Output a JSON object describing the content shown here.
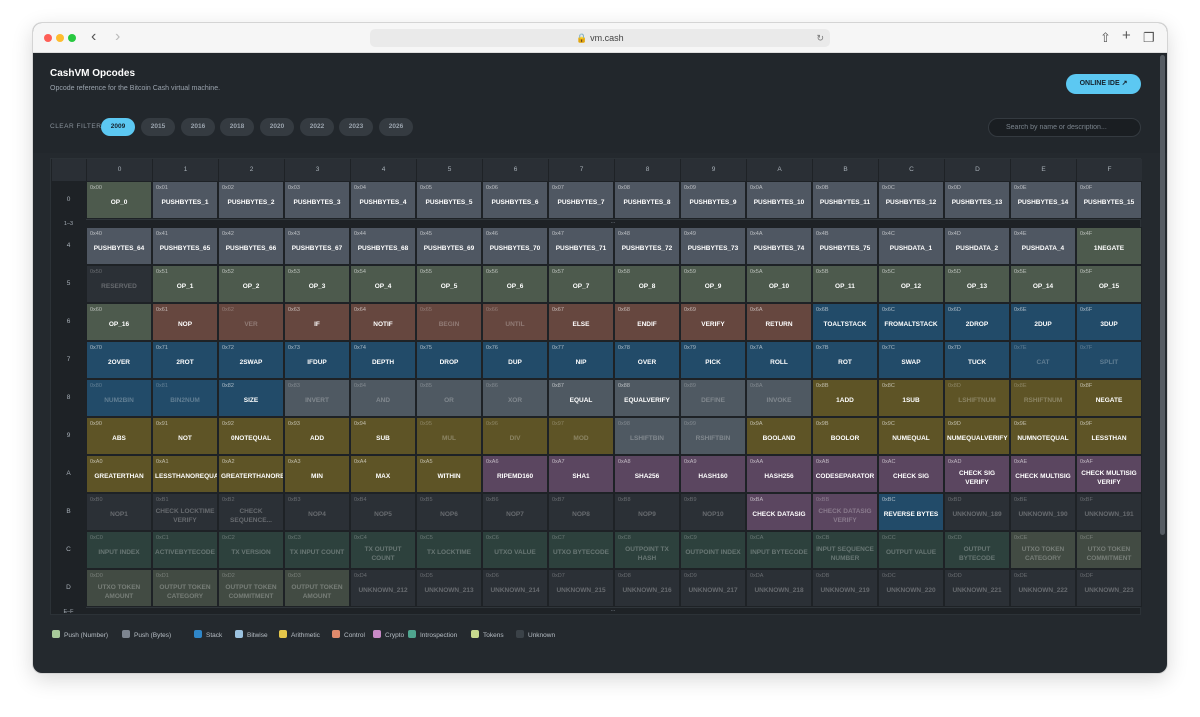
{
  "browser": {
    "url": "vm.cash",
    "back": "‹",
    "forward": "›"
  },
  "header": {
    "title": "CashVM Opcodes",
    "subtitle": "Opcode reference for the Bitcoin Cash virtual machine.",
    "ide_label": "ONLINE IDE ↗"
  },
  "filters": {
    "clear": "CLEAR FILTER",
    "years": [
      "2009",
      "2015",
      "2016",
      "2018",
      "2020",
      "2022",
      "2023",
      "2026"
    ],
    "active": "2009"
  },
  "search": {
    "placeholder": "Search by name or description..."
  },
  "colors": {
    "push_number": "#4d5a4d",
    "push_bytes": "#4f5762",
    "stack": "#224b69",
    "bitwise": "#4f5962",
    "arithmetic": "#5e5426",
    "control": "#66473f",
    "crypto": "#5b4660",
    "introspection": "#2d413d",
    "tokens": "#424b43",
    "unknown": "#2b3036",
    "reserved": "#2b3036"
  },
  "columns": [
    "0",
    "1",
    "2",
    "3",
    "4",
    "5",
    "6",
    "7",
    "8",
    "9",
    "A",
    "B",
    "C",
    "D",
    "E",
    "F"
  ],
  "row_labels": [
    "0",
    "1–3",
    "4",
    "5",
    "6",
    "7",
    "8",
    "9",
    "A",
    "B",
    "C",
    "D",
    "E–F"
  ],
  "ellipsis": "...",
  "grid": [
    {
      "label": "0",
      "cells": [
        [
          "0x00",
          "OP_0",
          "pn",
          0
        ],
        [
          "0x01",
          "PUSHBYTES_1",
          "pb",
          0
        ],
        [
          "0x02",
          "PUSHBYTES_2",
          "pb",
          0
        ],
        [
          "0x03",
          "PUSHBYTES_3",
          "pb",
          0
        ],
        [
          "0x04",
          "PUSHBYTES_4",
          "pb",
          0
        ],
        [
          "0x05",
          "PUSHBYTES_5",
          "pb",
          0
        ],
        [
          "0x06",
          "PUSHBYTES_6",
          "pb",
          0
        ],
        [
          "0x07",
          "PUSHBYTES_7",
          "pb",
          0
        ],
        [
          "0x08",
          "PUSHBYTES_8",
          "pb",
          0
        ],
        [
          "0x09",
          "PUSHBYTES_9",
          "pb",
          0
        ],
        [
          "0x0A",
          "PUSHBYTES_10",
          "pb",
          0
        ],
        [
          "0x0B",
          "PUSHBYTES_11",
          "pb",
          0
        ],
        [
          "0x0C",
          "PUSHBYTES_12",
          "pb",
          0
        ],
        [
          "0x0D",
          "PUSHBYTES_13",
          "pb",
          0
        ],
        [
          "0x0E",
          "PUSHBYTES_14",
          "pb",
          0
        ],
        [
          "0x0F",
          "PUSHBYTES_15",
          "pb",
          0
        ]
      ]
    },
    {
      "label": "4",
      "cells": [
        [
          "0x40",
          "PUSHBYTES_64",
          "pb",
          0
        ],
        [
          "0x41",
          "PUSHBYTES_65",
          "pb",
          0
        ],
        [
          "0x42",
          "PUSHBYTES_66",
          "pb",
          0
        ],
        [
          "0x43",
          "PUSHBYTES_67",
          "pb",
          0
        ],
        [
          "0x44",
          "PUSHBYTES_68",
          "pb",
          0
        ],
        [
          "0x45",
          "PUSHBYTES_69",
          "pb",
          0
        ],
        [
          "0x46",
          "PUSHBYTES_70",
          "pb",
          0
        ],
        [
          "0x47",
          "PUSHBYTES_71",
          "pb",
          0
        ],
        [
          "0x48",
          "PUSHBYTES_72",
          "pb",
          0
        ],
        [
          "0x49",
          "PUSHBYTES_73",
          "pb",
          0
        ],
        [
          "0x4A",
          "PUSHBYTES_74",
          "pb",
          0
        ],
        [
          "0x4B",
          "PUSHBYTES_75",
          "pb",
          0
        ],
        [
          "0x4C",
          "PUSHDATA_1",
          "pb",
          0
        ],
        [
          "0x4D",
          "PUSHDATA_2",
          "pb",
          0
        ],
        [
          "0x4E",
          "PUSHDATA_4",
          "pb",
          0
        ],
        [
          "0x4F",
          "1NEGATE",
          "pn",
          0
        ]
      ]
    },
    {
      "label": "5",
      "cells": [
        [
          "0x50",
          "RESERVED",
          "rs",
          1
        ],
        [
          "0x51",
          "OP_1",
          "pn",
          0
        ],
        [
          "0x52",
          "OP_2",
          "pn",
          0
        ],
        [
          "0x53",
          "OP_3",
          "pn",
          0
        ],
        [
          "0x54",
          "OP_4",
          "pn",
          0
        ],
        [
          "0x55",
          "OP_5",
          "pn",
          0
        ],
        [
          "0x56",
          "OP_6",
          "pn",
          0
        ],
        [
          "0x57",
          "OP_7",
          "pn",
          0
        ],
        [
          "0x58",
          "OP_8",
          "pn",
          0
        ],
        [
          "0x59",
          "OP_9",
          "pn",
          0
        ],
        [
          "0x5A",
          "OP_10",
          "pn",
          0
        ],
        [
          "0x5B",
          "OP_11",
          "pn",
          0
        ],
        [
          "0x5C",
          "OP_12",
          "pn",
          0
        ],
        [
          "0x5D",
          "OP_13",
          "pn",
          0
        ],
        [
          "0x5E",
          "OP_14",
          "pn",
          0
        ],
        [
          "0x5F",
          "OP_15",
          "pn",
          0
        ]
      ]
    },
    {
      "label": "6",
      "cells": [
        [
          "0x60",
          "OP_16",
          "pn",
          0
        ],
        [
          "0x61",
          "NOP",
          "ct",
          0
        ],
        [
          "0x62",
          "VER",
          "ct",
          1
        ],
        [
          "0x63",
          "IF",
          "ct",
          0
        ],
        [
          "0x64",
          "NOTIF",
          "ct",
          0
        ],
        [
          "0x65",
          "BEGIN",
          "ct",
          1
        ],
        [
          "0x66",
          "UNTIL",
          "ct",
          1
        ],
        [
          "0x67",
          "ELSE",
          "ct",
          0
        ],
        [
          "0x68",
          "ENDIF",
          "ct",
          0
        ],
        [
          "0x69",
          "VERIFY",
          "ct",
          0
        ],
        [
          "0x6A",
          "RETURN",
          "ct",
          0
        ],
        [
          "0x6B",
          "TOALTSTACK",
          "st",
          0
        ],
        [
          "0x6C",
          "FROMALTSTACK",
          "st",
          0
        ],
        [
          "0x6D",
          "2DROP",
          "st",
          0
        ],
        [
          "0x6E",
          "2DUP",
          "st",
          0
        ],
        [
          "0x6F",
          "3DUP",
          "st",
          0
        ]
      ]
    },
    {
      "label": "7",
      "cells": [
        [
          "0x70",
          "2OVER",
          "st",
          0
        ],
        [
          "0x71",
          "2ROT",
          "st",
          0
        ],
        [
          "0x72",
          "2SWAP",
          "st",
          0
        ],
        [
          "0x73",
          "IFDUP",
          "st",
          0
        ],
        [
          "0x74",
          "DEPTH",
          "st",
          0
        ],
        [
          "0x75",
          "DROP",
          "st",
          0
        ],
        [
          "0x76",
          "DUP",
          "st",
          0
        ],
        [
          "0x77",
          "NIP",
          "st",
          0
        ],
        [
          "0x78",
          "OVER",
          "st",
          0
        ],
        [
          "0x79",
          "PICK",
          "st",
          0
        ],
        [
          "0x7A",
          "ROLL",
          "st",
          0
        ],
        [
          "0x7B",
          "ROT",
          "st",
          0
        ],
        [
          "0x7C",
          "SWAP",
          "st",
          0
        ],
        [
          "0x7D",
          "TUCK",
          "st",
          0
        ],
        [
          "0x7E",
          "CAT",
          "st",
          1
        ],
        [
          "0x7F",
          "SPLIT",
          "st",
          1
        ]
      ]
    },
    {
      "label": "8",
      "cells": [
        [
          "0x80",
          "NUM2BIN",
          "st",
          1
        ],
        [
          "0x81",
          "BIN2NUM",
          "st",
          1
        ],
        [
          "0x82",
          "SIZE",
          "st",
          0
        ],
        [
          "0x83",
          "INVERT",
          "bw",
          1
        ],
        [
          "0x84",
          "AND",
          "bw",
          1
        ],
        [
          "0x85",
          "OR",
          "bw",
          1
        ],
        [
          "0x86",
          "XOR",
          "bw",
          1
        ],
        [
          "0x87",
          "EQUAL",
          "bw",
          0
        ],
        [
          "0x88",
          "EQUALVERIFY",
          "bw",
          0
        ],
        [
          "0x89",
          "DEFINE",
          "bw",
          1
        ],
        [
          "0x8A",
          "INVOKE",
          "bw",
          1
        ],
        [
          "0x8B",
          "1ADD",
          "ar",
          0
        ],
        [
          "0x8C",
          "1SUB",
          "ar",
          0
        ],
        [
          "0x8D",
          "LSHIFTNUM",
          "ar",
          1
        ],
        [
          "0x8E",
          "RSHIFTNUM",
          "ar",
          1
        ],
        [
          "0x8F",
          "NEGATE",
          "ar",
          0
        ]
      ]
    },
    {
      "label": "9",
      "cells": [
        [
          "0x90",
          "ABS",
          "ar",
          0
        ],
        [
          "0x91",
          "NOT",
          "ar",
          0
        ],
        [
          "0x92",
          "0NOTEQUAL",
          "ar",
          0
        ],
        [
          "0x93",
          "ADD",
          "ar",
          0
        ],
        [
          "0x94",
          "SUB",
          "ar",
          0
        ],
        [
          "0x95",
          "MUL",
          "ar",
          1
        ],
        [
          "0x96",
          "DIV",
          "ar",
          1
        ],
        [
          "0x97",
          "MOD",
          "ar",
          1
        ],
        [
          "0x98",
          "LSHIFTBIN",
          "bw",
          1
        ],
        [
          "0x99",
          "RSHIFTBIN",
          "bw",
          1
        ],
        [
          "0x9A",
          "BOOLAND",
          "ar",
          0
        ],
        [
          "0x9B",
          "BOOLOR",
          "ar",
          0
        ],
        [
          "0x9C",
          "NUMEQUAL",
          "ar",
          0
        ],
        [
          "0x9D",
          "NUMEQUALVERIFY",
          "ar",
          0
        ],
        [
          "0x9E",
          "NUMNOTEQUAL",
          "ar",
          0
        ],
        [
          "0x9F",
          "LESSTHAN",
          "ar",
          0
        ]
      ]
    },
    {
      "label": "A",
      "cells": [
        [
          "0xA0",
          "GREATERTHAN",
          "ar",
          0
        ],
        [
          "0xA1",
          "LESSTHANOREQUAL",
          "ar",
          0
        ],
        [
          "0xA2",
          "GREATERTHANOREQUAL",
          "ar",
          0
        ],
        [
          "0xA3",
          "MIN",
          "ar",
          0
        ],
        [
          "0xA4",
          "MAX",
          "ar",
          0
        ],
        [
          "0xA5",
          "WITHIN",
          "ar",
          0
        ],
        [
          "0xA6",
          "RIPEMD160",
          "cr",
          0
        ],
        [
          "0xA7",
          "SHA1",
          "cr",
          0
        ],
        [
          "0xA8",
          "SHA256",
          "cr",
          0
        ],
        [
          "0xA9",
          "HASH160",
          "cr",
          0
        ],
        [
          "0xAA",
          "HASH256",
          "cr",
          0
        ],
        [
          "0xAB",
          "CODESEPARATOR",
          "cr",
          0
        ],
        [
          "0xAC",
          "CHECK SIG",
          "cr",
          0
        ],
        [
          "0xAD",
          "CHECK SIG VERIFY",
          "cr",
          0
        ],
        [
          "0xAE",
          "CHECK MULTISIG",
          "cr",
          0
        ],
        [
          "0xAF",
          "CHECK MULTISIG VERIFY",
          "cr",
          0
        ]
      ]
    },
    {
      "label": "B",
      "cells": [
        [
          "0xB0",
          "NOP1",
          "un",
          1
        ],
        [
          "0xB1",
          "CHECK LOCKTIME VERIFY",
          "un",
          1
        ],
        [
          "0xB2",
          "CHECK SEQUENCE...",
          "un",
          1
        ],
        [
          "0xB3",
          "NOP4",
          "un",
          1
        ],
        [
          "0xB4",
          "NOP5",
          "un",
          1
        ],
        [
          "0xB5",
          "NOP6",
          "un",
          1
        ],
        [
          "0xB6",
          "NOP7",
          "un",
          1
        ],
        [
          "0xB7",
          "NOP8",
          "un",
          1
        ],
        [
          "0xB8",
          "NOP9",
          "un",
          1
        ],
        [
          "0xB9",
          "NOP10",
          "un",
          1
        ],
        [
          "0xBA",
          "CHECK DATASIG",
          "cr",
          0
        ],
        [
          "0xBB",
          "CHECK DATASIG VERIFY",
          "cr",
          1
        ],
        [
          "0xBC",
          "REVERSE BYTES",
          "st",
          0
        ],
        [
          "0xBD",
          "UNKNOWN_189",
          "un",
          1
        ],
        [
          "0xBE",
          "UNKNOWN_190",
          "un",
          1
        ],
        [
          "0xBF",
          "UNKNOWN_191",
          "un",
          1
        ]
      ]
    },
    {
      "label": "C",
      "cells": [
        [
          "0xC0",
          "INPUT INDEX",
          "in",
          1
        ],
        [
          "0xC1",
          "ACTIVEBYTECODE",
          "in",
          1
        ],
        [
          "0xC2",
          "TX VERSION",
          "in",
          1
        ],
        [
          "0xC3",
          "TX INPUT COUNT",
          "in",
          1
        ],
        [
          "0xC4",
          "TX OUTPUT COUNT",
          "in",
          1
        ],
        [
          "0xC5",
          "TX LOCKTIME",
          "in",
          1
        ],
        [
          "0xC6",
          "UTXO VALUE",
          "in",
          1
        ],
        [
          "0xC7",
          "UTXO BYTECODE",
          "in",
          1
        ],
        [
          "0xC8",
          "OUTPOINT TX HASH",
          "in",
          1
        ],
        [
          "0xC9",
          "OUTPOINT INDEX",
          "in",
          1
        ],
        [
          "0xCA",
          "INPUT BYTECODE",
          "in",
          1
        ],
        [
          "0xCB",
          "INPUT SEQUENCE NUMBER",
          "in",
          1
        ],
        [
          "0xCC",
          "OUTPUT VALUE",
          "in",
          1
        ],
        [
          "0xCD",
          "OUTPUT BYTECODE",
          "in",
          1
        ],
        [
          "0xCE",
          "UTXO TOKEN CATEGORY",
          "tk",
          1
        ],
        [
          "0xCF",
          "UTXO TOKEN COMMITMENT",
          "tk",
          1
        ]
      ]
    },
    {
      "label": "D",
      "cells": [
        [
          "0xD0",
          "UTXO TOKEN AMOUNT",
          "tk",
          1
        ],
        [
          "0xD1",
          "OUTPUT TOKEN CATEGORY",
          "tk",
          1
        ],
        [
          "0xD2",
          "OUTPUT TOKEN COMMITMENT",
          "tk",
          1
        ],
        [
          "0xD3",
          "OUTPUT TOKEN AMOUNT",
          "tk",
          1
        ],
        [
          "0xD4",
          "UNKNOWN_212",
          "un",
          1
        ],
        [
          "0xD5",
          "UNKNOWN_213",
          "un",
          1
        ],
        [
          "0xD6",
          "UNKNOWN_214",
          "un",
          1
        ],
        [
          "0xD7",
          "UNKNOWN_215",
          "un",
          1
        ],
        [
          "0xD8",
          "UNKNOWN_216",
          "un",
          1
        ],
        [
          "0xD9",
          "UNKNOWN_217",
          "un",
          1
        ],
        [
          "0xDA",
          "UNKNOWN_218",
          "un",
          1
        ],
        [
          "0xDB",
          "UNKNOWN_219",
          "un",
          1
        ],
        [
          "0xDC",
          "UNKNOWN_220",
          "un",
          1
        ],
        [
          "0xDD",
          "UNKNOWN_221",
          "un",
          1
        ],
        [
          "0xDE",
          "UNKNOWN_222",
          "un",
          1
        ],
        [
          "0xDF",
          "UNKNOWN_223",
          "un",
          1
        ]
      ]
    }
  ],
  "legend": [
    {
      "label": "Push (Number)",
      "color": "#a8c99a"
    },
    {
      "label": "Push (Bytes)",
      "color": "#7d8590"
    },
    {
      "label": "Stack",
      "color": "#2f86c8"
    },
    {
      "label": "Bitwise",
      "color": "#9cc3e0"
    },
    {
      "label": "Arithmetic",
      "color": "#e5c64a"
    },
    {
      "label": "Control",
      "color": "#e08a6c"
    },
    {
      "label": "Crypto",
      "color": "#c98ac7"
    },
    {
      "label": "Introspection",
      "color": "#4fa58f"
    },
    {
      "label": "Tokens",
      "color": "#c7d98e"
    },
    {
      "label": "Unknown",
      "color": "#3b4248"
    }
  ]
}
